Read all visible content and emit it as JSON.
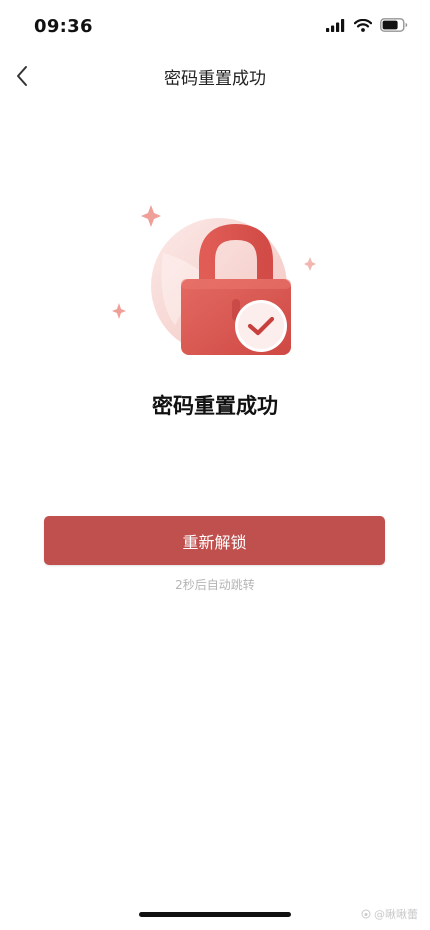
{
  "status_bar": {
    "time": "09:36",
    "icons": [
      "signal-icon",
      "wifi-icon",
      "battery-icon"
    ]
  },
  "nav": {
    "title": "密码重置成功",
    "back_icon": "chevron-left-icon"
  },
  "illustration": {
    "icon": "lock-check-icon",
    "colors": {
      "lock": "#d9514e",
      "lock_light": "#ee8d86",
      "circle_bg": "#f8dcd8",
      "check": "#c7403d",
      "sparkle": "#ef9e98"
    }
  },
  "result": {
    "title": "密码重置成功"
  },
  "actions": {
    "unlock_label": "重新解锁",
    "accent": "#c0504d"
  },
  "hint": {
    "redirect_text": "2秒后自动跳转"
  },
  "watermark": {
    "text": "@啾啾蕾"
  }
}
